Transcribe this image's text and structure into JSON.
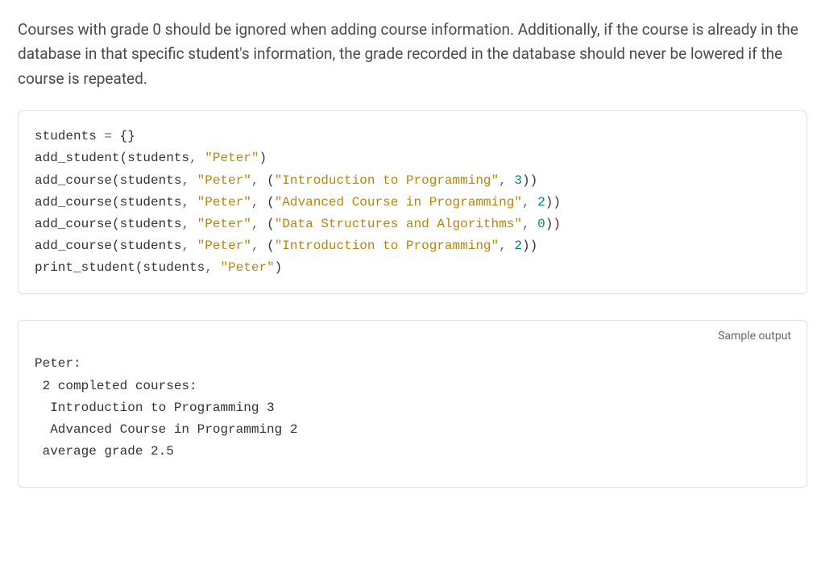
{
  "description": "Courses with grade 0 should be ignored when adding course information. Additionally, if the course is already in the database in that specific student's information, the grade recorded in the database should never be lowered if the course is repeated.",
  "code": {
    "l1_a": "students ",
    "l1_b": "=",
    "l1_c": " {}",
    "l2_a": "add_student(students",
    "l2_b": ",",
    "l2_c": " ",
    "l2_d": "\"Peter\"",
    "l2_e": ")",
    "l3_a": "add_course(students",
    "l3_b": ",",
    "l3_c": " ",
    "l3_d": "\"Peter\"",
    "l3_e": ",",
    "l3_f": " (",
    "l3_g": "\"Introduction to Programming\"",
    "l3_h": ",",
    "l3_i": " ",
    "l3_j": "3",
    "l3_k": "))",
    "l4_a": "add_course(students",
    "l4_b": ",",
    "l4_c": " ",
    "l4_d": "\"Peter\"",
    "l4_e": ",",
    "l4_f": " (",
    "l4_g": "\"Advanced Course in Programming\"",
    "l4_h": ",",
    "l4_i": " ",
    "l4_j": "2",
    "l4_k": "))",
    "l5_a": "add_course(students",
    "l5_b": ",",
    "l5_c": " ",
    "l5_d": "\"Peter\"",
    "l5_e": ",",
    "l5_f": " (",
    "l5_g": "\"Data Structures and Algorithms\"",
    "l5_h": ",",
    "l5_i": " ",
    "l5_j": "0",
    "l5_k": "))",
    "l6_a": "add_course(students",
    "l6_b": ",",
    "l6_c": " ",
    "l6_d": "\"Peter\"",
    "l6_e": ",",
    "l6_f": " (",
    "l6_g": "\"Introduction to Programming\"",
    "l6_h": ",",
    "l6_i": " ",
    "l6_j": "2",
    "l6_k": "))",
    "l7_a": "print_student(students",
    "l7_b": ",",
    "l7_c": " ",
    "l7_d": "\"Peter\"",
    "l7_e": ")"
  },
  "output_label": "Sample output",
  "output": "Peter:\n 2 completed courses:\n  Introduction to Programming 3\n  Advanced Course in Programming 2\n average grade 2.5"
}
